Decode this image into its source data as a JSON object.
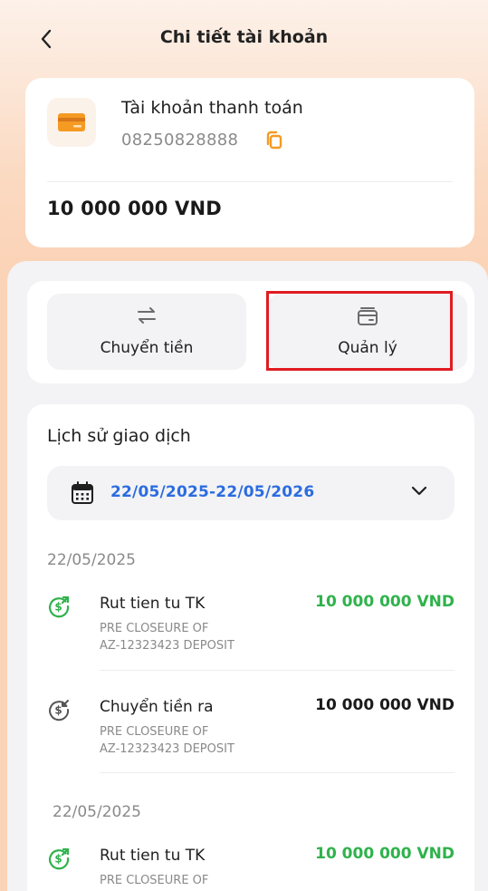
{
  "header": {
    "title": "Chi tiết tài khoản",
    "back_icon": "chevron-left-icon"
  },
  "account": {
    "name": "Tài khoản thanh toán",
    "number": "08250828888",
    "balance": "10 000 000 VND",
    "icon": "card-icon",
    "accent_color": "#f59a23"
  },
  "actions": [
    {
      "label": "Chuyển tiền",
      "icon": "transfer-arrows-icon"
    },
    {
      "label": "Quản lý",
      "icon": "cards-stack-icon"
    }
  ],
  "history": {
    "title": "Lịch sử giao dịch",
    "date_range": "22/05/2025-22/05/2026",
    "range_color": "#2b6ce0",
    "groups": [
      {
        "date": "22/05/2025",
        "items": [
          {
            "name": "Rut tien tu TK",
            "desc1": "PRE CLOSEURE OF",
            "desc2": "AZ-12323423 DEPOSIT",
            "amount": "10 000 000 VND",
            "direction": "in",
            "color": "#2fb24c"
          },
          {
            "name": "Chuyển tiền ra",
            "desc1": "PRE CLOSEURE OF",
            "desc2": "AZ-12323423 DEPOSIT",
            "amount": "10 000 000 VND",
            "direction": "out",
            "color": "#1a1a1a"
          }
        ]
      },
      {
        "date": "22/05/2025",
        "items": [
          {
            "name": "Rut tien tu TK",
            "desc1": "PRE CLOSEURE OF",
            "desc2": "",
            "amount": "10 000 000 VND",
            "direction": "in",
            "color": "#2fb24c"
          }
        ]
      }
    ]
  }
}
